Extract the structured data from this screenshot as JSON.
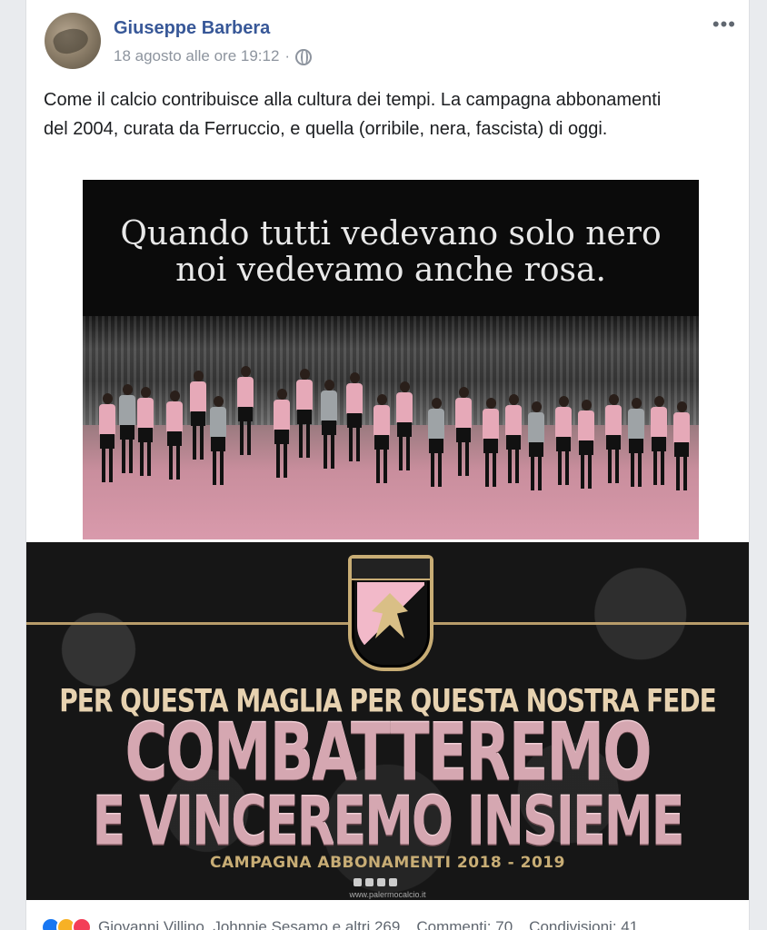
{
  "post": {
    "author": "Giuseppe Barbera",
    "timestamp": "18 agosto alle ore 19:12",
    "separator": "·",
    "privacy_icon": "globe-icon",
    "more_label": "•••",
    "text": "Come il calcio contribuisce alla cultura dei tempi. La campagna abbonamenti del 2004, curata da Ferruccio, e quella (orribile, nera, fascista) di oggi."
  },
  "image1": {
    "headline_line1": "Quando tutti vedevano solo nero",
    "headline_line2": "noi vedevamo anche rosa."
  },
  "image2": {
    "line1": "PER QUESTA MAGLIA  PER QUESTA NOSTRA FEDE",
    "line2": "COMBATTEREMO",
    "line3": "E VINCEREMO INSIEME",
    "line4": "CAMPAGNA ABBONAMENTI 2018 - 2019",
    "website": "www.palermocalcio.it"
  },
  "footer": {
    "reactions": [
      "like-icon",
      "haha-icon",
      "love-icon"
    ],
    "reacted_by": "Giovanni Villino, Johnnie Sesamo e altri 269",
    "comments": "Commenti: 70",
    "shares": "Condivisioni: 41"
  },
  "colors": {
    "author_blue": "#385898",
    "pink": "#f2b9c9",
    "gold": "#c8ad75"
  }
}
